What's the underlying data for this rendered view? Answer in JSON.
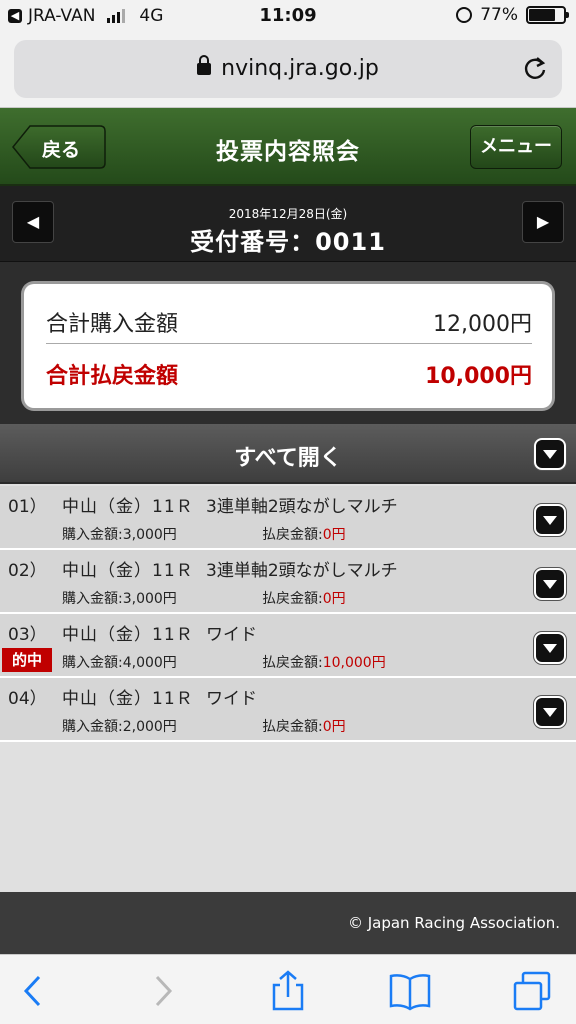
{
  "status_bar": {
    "carrier": "JRA-VAN",
    "network": "4G",
    "time": "11:09",
    "battery": "77%",
    "battery_level": 0.77
  },
  "browser": {
    "url": "nvinq.jra.go.jp"
  },
  "header": {
    "back_label": "戻る",
    "title": "投票内容照会",
    "menu_label": "メニュー"
  },
  "receipt": {
    "date": "2018年12月28日(金)",
    "number_label": "受付番号：0011"
  },
  "summary": {
    "purchase_label": "合計購入金額",
    "purchase_value": "12,000円",
    "payout_label": "合計払戻金額",
    "payout_value": "10,000円"
  },
  "expand_all_label": "すべて開く",
  "bets": [
    {
      "no": "01）",
      "race": "中山（金）11Ｒ",
      "type": "3連単軸2頭ながしマルチ",
      "buy": "購入金額:3,000円",
      "pay_label": "払戻金額:",
      "pay_value": "0円",
      "hit": ""
    },
    {
      "no": "02）",
      "race": "中山（金）11Ｒ",
      "type": "3連単軸2頭ながしマルチ",
      "buy": "購入金額:3,000円",
      "pay_label": "払戻金額:",
      "pay_value": "0円",
      "hit": ""
    },
    {
      "no": "03）",
      "race": "中山（金）11Ｒ",
      "type": "ワイド",
      "buy": "購入金額:4,000円",
      "pay_label": "払戻金額:",
      "pay_value": "10,000円",
      "hit": "的中"
    },
    {
      "no": "04）",
      "race": "中山（金）11Ｒ",
      "type": "ワイド",
      "buy": "購入金額:2,000円",
      "pay_label": "払戻金額:",
      "pay_value": "0円",
      "hit": ""
    }
  ],
  "footer": {
    "copyright": "© Japan Racing Association."
  },
  "colors": {
    "header_green": "#2f5a22",
    "accent_red": "#c00000",
    "dark_band": "#202020"
  }
}
